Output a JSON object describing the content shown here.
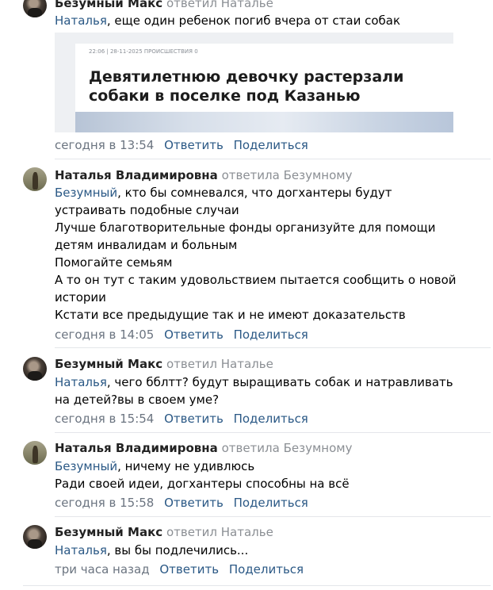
{
  "comments": [
    {
      "author": "Безумный Макс",
      "replied": "ответил Наталье",
      "mention": "Наталья",
      "lines": [
        ", еще один ребенок погиб вчера от стаи собак"
      ],
      "date": "сегодня в 13:54",
      "reply": "Ответить",
      "share": "Поделиться"
    },
    {
      "author": "Наталья Владимировна",
      "replied": "ответила Безумному",
      "mention": "Безумный",
      "lines": [
        ", кто бы сомневался, что догхантеры будут устраивать подобные случаи",
        "Лучше благотворительные фонды организуйте для помощи детям инвалидам и больным",
        "Помогайте семьям",
        "А то он тут с таким удовольствием пытается сообщить о новой истории",
        "Кстати все предыдущие так и не имеют доказательств"
      ],
      "date": "сегодня в 14:05",
      "reply": "Ответить",
      "share": "Поделиться"
    },
    {
      "author": "Безумный Макс",
      "replied": "ответил Наталье",
      "mention": "Наталья",
      "lines": [
        ", чего бблтт? будут выращивать собак и натравливать на детей?вы в своем уме?"
      ],
      "date": "сегодня в 15:54",
      "reply": "Ответить",
      "share": "Поделиться"
    },
    {
      "author": "Наталья Владимировна",
      "replied": "ответила Безумному",
      "mention": "Безумный",
      "lines": [
        ", ничему не удивлюсь",
        "Ради своей идеи, догхантеры способны на всё"
      ],
      "date": "сегодня в 15:58",
      "reply": "Ответить",
      "share": "Поделиться"
    },
    {
      "author": "Безумный Макс",
      "replied": "ответил Наталье",
      "mention": "Наталья",
      "lines": [
        ", вы бы подлечились..."
      ],
      "date": "три часа назад",
      "reply": "Ответить",
      "share": "Поделиться"
    }
  ],
  "article": {
    "meta": "22:06 | 28-11-2025   ПРОИСШЕСТВИЯ   0",
    "title": "Девятилетнюю девочку растерзали собаки в поселке под Казанью"
  }
}
